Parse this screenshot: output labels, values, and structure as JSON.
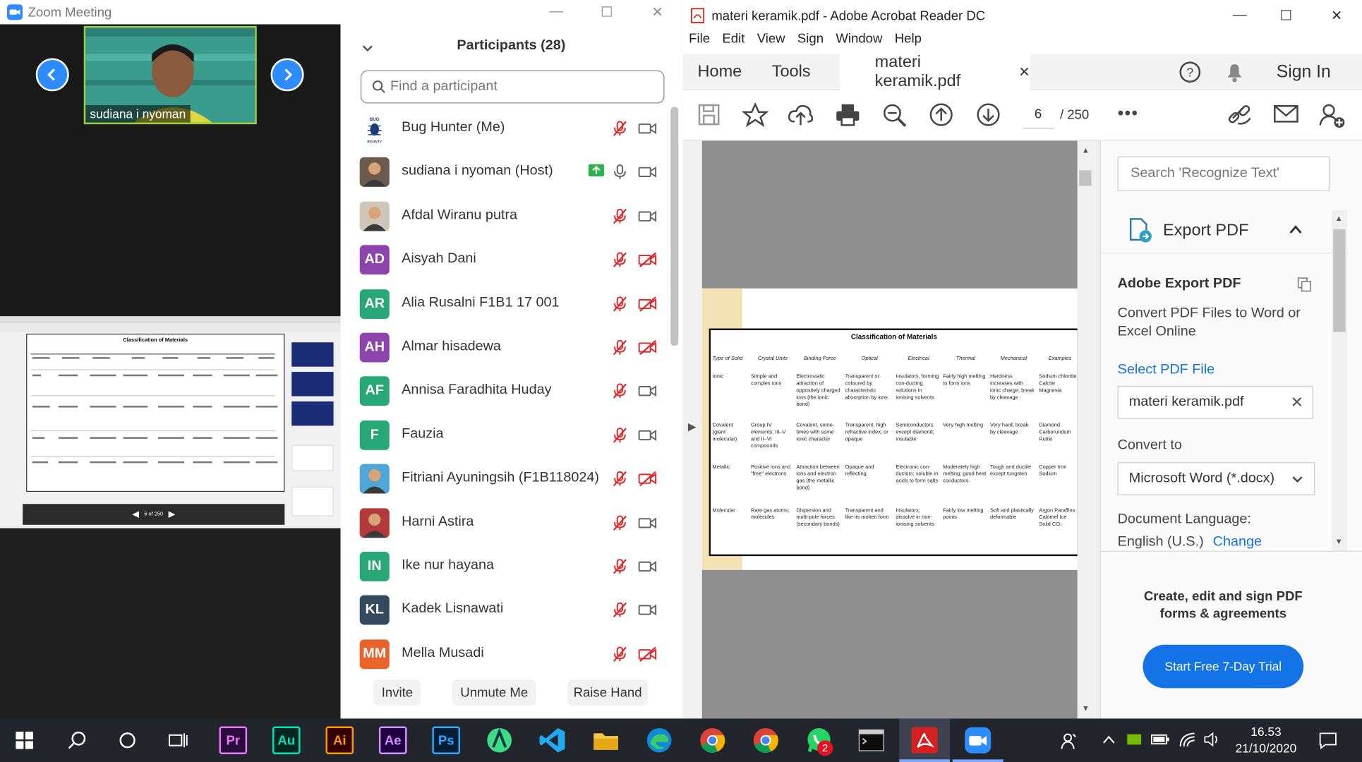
{
  "zoom": {
    "title": "Zoom Meeting",
    "video": {
      "speaker_name": "sudiana i nyoman"
    },
    "shared_screen": {
      "page_indicator": "6 of 250",
      "table_title": "Classification of Materials"
    },
    "participants": {
      "header": "Participants (28)",
      "search_placeholder": "Find a participant",
      "items": [
        {
          "name": "Bug Hunter (Me)",
          "initials": "",
          "color": "#ffffff",
          "avatar": "bug-bounty-logo"
        },
        {
          "name": "sudiana i nyoman (Host)",
          "initials": "",
          "color": "#6b5b4a",
          "avatar": "photo"
        },
        {
          "name": "Afdal Wiranu putra",
          "initials": "",
          "color": "#cfc6b8",
          "avatar": "photo"
        },
        {
          "name": "Aisyah Dani",
          "initials": "AD",
          "color": "#8e44ad"
        },
        {
          "name": "Alia Rusalni F1B1 17 001",
          "initials": "AR",
          "color": "#27a876"
        },
        {
          "name": "Almar hisadewa",
          "initials": "AH",
          "color": "#8e44ad"
        },
        {
          "name": "Annisa Faradhita Huday",
          "initials": "AF",
          "color": "#27a876"
        },
        {
          "name": "Fauzia",
          "initials": "F",
          "color": "#27a876"
        },
        {
          "name": "Fitriani Ayuningsih (F1B118024)",
          "initials": "",
          "color": "#4ea7d6",
          "avatar": "photo"
        },
        {
          "name": "Harni Astira",
          "initials": "",
          "color": "#b23a3a",
          "avatar": "photo"
        },
        {
          "name": "Ike nur hayana",
          "initials": "IN",
          "color": "#27a876"
        },
        {
          "name": "Kadek Lisnawati",
          "initials": "KL",
          "color": "#34495e"
        },
        {
          "name": "Mella Musadi",
          "initials": "MM",
          "color": "#e8642b"
        }
      ],
      "buttons": {
        "invite": "Invite",
        "unmute": "Unmute Me",
        "raise_hand": "Raise Hand"
      }
    }
  },
  "acrobat": {
    "title": "materi keramik.pdf - Adobe Acrobat Reader DC",
    "menu": [
      "File",
      "Edit",
      "View",
      "Sign",
      "Window",
      "Help"
    ],
    "tabs": {
      "home": "Home",
      "tools": "Tools",
      "document": "materi keramik.pdf"
    },
    "sign_in": "Sign In",
    "page_current": "6",
    "page_total": "/ 250",
    "pdf_table": {
      "title": "Classification of Materials",
      "headers": [
        "Type of Solid",
        "Crystal Units",
        "Binding Force",
        "Optical",
        "Electrical",
        "Thermal",
        "Mechanical",
        "Examples"
      ],
      "rows": [
        [
          "Ionic",
          "Simple and complex ions",
          "Electrostatic attraction of oppositely charged ions (the ionic bond)",
          "Transparent or coloured by characteristic absorption by ions",
          "Insulators, forming con-ducting solutions in ionising solvents",
          "Fairly high melting to form ions",
          "Hardness increases with ionic charge; break by cleavage",
          "Sodium chloride Calcite Magnesia"
        ],
        [
          "Covalent (giant molecular)",
          "Group IV elements; III–V and II–VI compounds",
          "Covalent, some-times with some ionic character",
          "Transparent, high refractive index; or opaque",
          "Semiconductors except diamond; insulable",
          "Very high melting",
          "Very hard; break by cleavage",
          "Diamond Carborundum Rutile"
        ],
        [
          "Metallic",
          "Positive ions and \"free\" electrons",
          "Attraction between ions and electron gas (the metallic bond)",
          "Opaque and reflecting",
          "Electronic con-ductors; soluble in acids to form salts",
          "Moderately high melting; good heat conductors",
          "Tough and ductile except tungsten",
          "Copper Iron Sodium"
        ],
        [
          "Molecular",
          "Rare gas atoms; molecules",
          "Dispersion and multi-pole forces (secondary bonds)",
          "Transparent and like its molten form",
          "Insulators; dissolve in non-ionising solvents",
          "Fairly low melting points",
          "Soft and plastically deformable",
          "Argon Paraffins Calomel Ice Solid CO₂"
        ]
      ]
    },
    "right_pane": {
      "search_placeholder": "Search 'Recognize Text'",
      "export_pdf": "Export PDF",
      "adobe_export_title": "Adobe Export PDF",
      "adobe_export_desc": "Convert PDF Files to Word or Excel Online",
      "select_pdf": "Select PDF File",
      "file_name": "materi keramik.pdf",
      "convert_to": "Convert to",
      "format": "Microsoft Word (*.docx)",
      "doc_lang_label": "Document Language:",
      "doc_lang_value": "English (U.S.)",
      "change": "Change",
      "promo": "Create, edit and sign PDF forms & agreements",
      "trial_button": "Start Free 7-Day Trial"
    }
  },
  "taskbar": {
    "apps": [
      "Pr",
      "Au",
      "Ai",
      "Ae",
      "Ps"
    ],
    "time": "16.53",
    "date": "21/10/2020",
    "whatsapp_badge": "2"
  }
}
